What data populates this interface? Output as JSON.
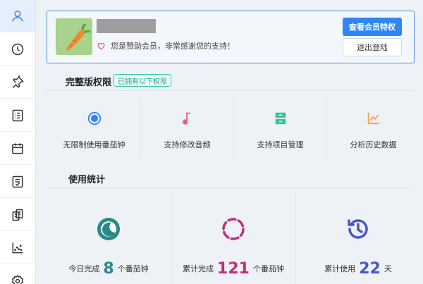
{
  "sidebar": {
    "items": [
      {
        "icon": "user-icon",
        "active": true
      },
      {
        "icon": "clock-icon",
        "active": false
      },
      {
        "icon": "pin-icon",
        "active": false
      },
      {
        "icon": "list-icon",
        "active": false
      },
      {
        "icon": "calendar-icon",
        "active": false
      },
      {
        "icon": "checklist-icon",
        "active": false
      },
      {
        "icon": "clipboard-icon",
        "active": false
      },
      {
        "icon": "scatter-chart-icon",
        "active": false
      },
      {
        "icon": "settings-icon",
        "active": false
      }
    ]
  },
  "member": {
    "message": "您是赞助会员，非常感谢您的支持！",
    "view_benefits_label": "查看会员特权",
    "logout_label": "退出登陆"
  },
  "features": {
    "title": "完整版权限",
    "badge": "已拥有以下权限",
    "items": [
      {
        "label": "无限制使用番茄钟",
        "icon": "target-icon",
        "color": "#2f87f5"
      },
      {
        "label": "支持修改音频",
        "icon": "music-note-icon",
        "color": "#ef5d71"
      },
      {
        "label": "支持项目管理",
        "icon": "drawer-icon",
        "color": "#3cc48e"
      },
      {
        "label": "分析历史数据",
        "icon": "trend-chart-icon",
        "color": "#f5a44a"
      }
    ]
  },
  "stats": {
    "title": "使用统计",
    "items": [
      {
        "prefix": "今日完成",
        "value": "8",
        "suffix": "个番茄钟",
        "icon": "moon-icon",
        "color": "#2a8a86"
      },
      {
        "prefix": "累计完成",
        "value": "121",
        "suffix": "个番茄钟",
        "icon": "loading-ring-icon",
        "color": "#bf2f7e"
      },
      {
        "prefix": "累计使用",
        "value": "22",
        "suffix": "天",
        "icon": "history-icon",
        "color": "#4c55c8"
      }
    ]
  }
}
